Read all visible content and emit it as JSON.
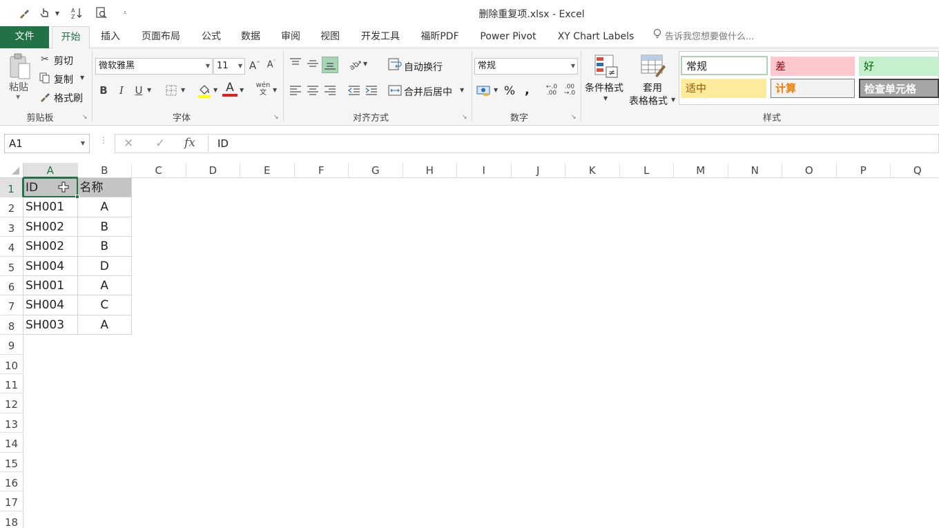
{
  "window": {
    "title": "删除重复项.xlsx - Excel"
  },
  "qat": {
    "icons": [
      "paint-brush-icon",
      "touch-mode-icon",
      "sort-icon",
      "print-preview-icon",
      "customize-icon"
    ]
  },
  "tabs": [
    {
      "label": "文件",
      "name": "tab-file"
    },
    {
      "label": "开始",
      "name": "tab-home"
    },
    {
      "label": "插入",
      "name": "tab-insert"
    },
    {
      "label": "页面布局",
      "name": "tab-page-layout"
    },
    {
      "label": "公式",
      "name": "tab-formulas"
    },
    {
      "label": "数据",
      "name": "tab-data"
    },
    {
      "label": "审阅",
      "name": "tab-review"
    },
    {
      "label": "视图",
      "name": "tab-view"
    },
    {
      "label": "开发工具",
      "name": "tab-developer"
    },
    {
      "label": "福昕PDF",
      "name": "tab-foxit-pdf"
    },
    {
      "label": "Power Pivot",
      "name": "tab-power-pivot"
    },
    {
      "label": "XY Chart Labels",
      "name": "tab-xy-chart-labels"
    }
  ],
  "tell_me": "告诉我您想要做什么...",
  "ribbon": {
    "clipboard": {
      "paste": "粘贴",
      "cut": "剪切",
      "copy": "复制",
      "format_painter": "格式刷",
      "label": "剪贴板"
    },
    "font": {
      "name": "微软雅黑",
      "size": "11",
      "bold": "B",
      "italic": "I",
      "underline": "U",
      "label": "字体",
      "font_color": "#e02020",
      "fill_color": "#ffff00"
    },
    "alignment": {
      "wrap_text": "自动换行",
      "merge_center": "合并后居中",
      "label": "对齐方式"
    },
    "number": {
      "format": "常规",
      "percent": "%",
      "comma": ",",
      "label": "数字"
    },
    "styles": {
      "conditional": "条件格式",
      "table_line1": "套用",
      "table_line2": "表格格式",
      "label": "样式",
      "cells": [
        {
          "text": "常规",
          "name": "style-normal",
          "bg": "#ffffff",
          "fg": "#222222",
          "border": "#a9d4b5"
        },
        {
          "text": "差",
          "name": "style-bad",
          "bg": "#ffc7ce",
          "fg": "#9c0006",
          "border": "#ffc7ce"
        },
        {
          "text": "好",
          "name": "style-good",
          "bg": "#c6efce",
          "fg": "#006100",
          "border": "#c6efce"
        },
        {
          "text": "适中",
          "name": "style-neutral",
          "bg": "#ffeb9c",
          "fg": "#9c5700",
          "border": "#ffeb9c"
        },
        {
          "text": "计算",
          "name": "style-calculation",
          "bg": "#f2f2f2",
          "fg": "#fa7d00",
          "border": "#7f7f7f"
        },
        {
          "text": "检查单元格",
          "name": "style-check-cell",
          "bg": "#a5a5a5",
          "fg": "#ffffff",
          "border": "#3f3f3f"
        }
      ]
    }
  },
  "formula_bar": {
    "name_box": "A1",
    "fx": "fx",
    "value": "ID"
  },
  "grid": {
    "columns": [
      "A",
      "B",
      "C",
      "D",
      "E",
      "F",
      "G",
      "H",
      "I",
      "J",
      "K",
      "L",
      "M",
      "N",
      "O",
      "P",
      "Q"
    ],
    "rows": [
      "1",
      "2",
      "3",
      "4",
      "5",
      "6",
      "7",
      "8",
      "9",
      "10",
      "11",
      "12",
      "13",
      "14",
      "15",
      "16",
      "17",
      "18"
    ],
    "header": [
      "ID",
      "名称"
    ],
    "data": [
      [
        "SH001",
        "A"
      ],
      [
        "SH002",
        "B"
      ],
      [
        "SH002",
        "B"
      ],
      [
        "SH004",
        "D"
      ],
      [
        "SH001",
        "A"
      ],
      [
        "SH004",
        "C"
      ],
      [
        "SH003",
        "A"
      ]
    ],
    "selected_column": "A",
    "selected_row": "1"
  }
}
